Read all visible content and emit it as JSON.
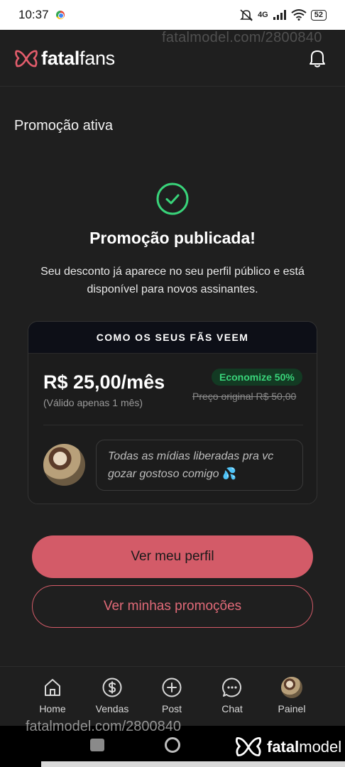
{
  "status_bar": {
    "time": "10:37",
    "network": "4G",
    "battery": "52"
  },
  "watermark": {
    "text": "fatalmodel.com/2800840",
    "brand_bold": "fatal",
    "brand_light": "model"
  },
  "header": {
    "logo_bold": "fatal",
    "logo_light": "fans"
  },
  "page": {
    "section_title": "Promoção ativa",
    "headline": "Promoção publicada!",
    "subtext": "Seu desconto já aparece no seu perfil público e está disponível para novos assinantes."
  },
  "preview_card": {
    "header": "COMO OS SEUS FÃS VEEM",
    "price": "R$ 25,00/mês",
    "validity": "(Válido apenas 1 mês)",
    "badge": "Economize 50%",
    "original_price": "Preço original R$ 50,00",
    "message": "Todas as mídias liberadas pra vc gozar gostoso comigo",
    "message_emoji": "💦"
  },
  "actions": {
    "primary": "Ver meu perfil",
    "secondary": "Ver minhas promoções"
  },
  "bottom_nav": [
    {
      "label": "Home",
      "icon": "home-icon"
    },
    {
      "label": "Vendas",
      "icon": "dollar-icon"
    },
    {
      "label": "Post",
      "icon": "plus-circle-icon"
    },
    {
      "label": "Chat",
      "icon": "chat-icon"
    },
    {
      "label": "Painel",
      "icon": "avatar"
    }
  ],
  "colors": {
    "accent": "#d35b68",
    "success": "#39d47a",
    "background": "#1f1f1f"
  }
}
